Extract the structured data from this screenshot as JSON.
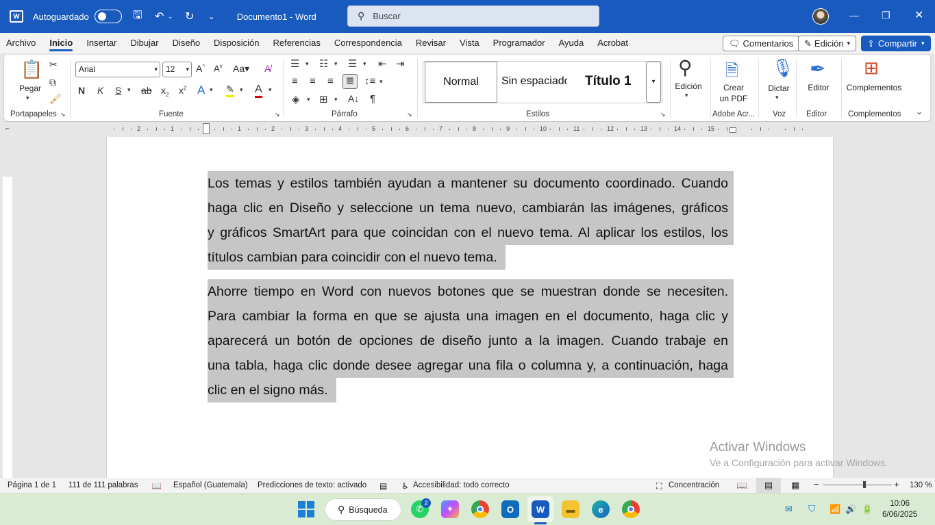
{
  "titlebar": {
    "autosave_label": "Autoguardado",
    "doc_title": "Documento1 - Word",
    "search_placeholder": "Buscar"
  },
  "menu": {
    "items": [
      "Archivo",
      "Inicio",
      "Insertar",
      "Dibujar",
      "Diseño",
      "Disposición",
      "Referencias",
      "Correspondencia",
      "Revisar",
      "Vista",
      "Programador",
      "Ayuda",
      "Acrobat"
    ],
    "active": "Inicio",
    "comments_label": "Comentarios",
    "edit_label": "Edición",
    "share_label": "Compartir"
  },
  "ribbon": {
    "clipboard": {
      "paste_label": "Pegar",
      "group_label": "Portapapeles"
    },
    "font": {
      "family": "Arial",
      "size": "12",
      "group_label": "Fuente"
    },
    "paragraph": {
      "group_label": "Párrafo"
    },
    "styles": {
      "normal": "Normal",
      "no_spacing": "Sin espaciado",
      "title1": "Título 1",
      "group_label": "Estilos"
    },
    "editing": {
      "label": "Edición"
    },
    "pdf": {
      "label_line1": "Crear",
      "label_line2": "un PDF",
      "group_label": "Adobe Acr..."
    },
    "voice": {
      "label": "Dictar",
      "group_label": "Voz"
    },
    "editor": {
      "label": "Editor",
      "group_label": "Editor"
    },
    "addins": {
      "label": "Complementos",
      "group_label": "Complementos"
    }
  },
  "ruler": {
    "numbers": [
      "2",
      "1",
      "1",
      "2",
      "3",
      "4",
      "5",
      "6",
      "7",
      "8",
      "9",
      "10",
      "11",
      "12",
      "13",
      "14",
      "15"
    ]
  },
  "document": {
    "paragraph1": [
      "Los temas y estilos también ayudan a mantener su documento coordinado. Cuando",
      "haga clic en Diseño y seleccione un tema nuevo, cambiarán las imágenes, gráficos",
      "y gráficos SmartArt para que coincidan con el nuevo tema. Al aplicar los estilos, los",
      "títulos cambian para coincidir con el nuevo tema."
    ],
    "paragraph2": [
      "Ahorre tiempo en Word con nuevos botones que se muestran donde se necesiten.",
      "Para cambiar la forma en que se ajusta una imagen en el documento, haga clic y",
      "aparecerá un botón de opciones de diseño junto a la imagen. Cuando trabaje en",
      "una tabla, haga clic donde desee agregar una fila o columna y, a continuación, haga",
      "clic en el signo más."
    ]
  },
  "watermark": {
    "line1": "Activar Windows",
    "line2": "Ve a Configuración para activar Windows."
  },
  "status": {
    "page": "Página 1 de 1",
    "words": "111 de 111 palabras",
    "language": "Español (Guatemala)",
    "predictions": "Predicciones de texto: activado",
    "accessibility": "Accesibilidad: todo correcto",
    "focus": "Concentración",
    "zoom": "130 %",
    "zoom_level": 130
  },
  "taskbar": {
    "search_label": "Búsqueda",
    "whatsapp_badge": "2",
    "time": "10:06",
    "date": "6/06/2025"
  },
  "colors": {
    "word_blue": "#185abd",
    "selection": "#c6c6c6",
    "taskbar": "#d9ecd3"
  }
}
